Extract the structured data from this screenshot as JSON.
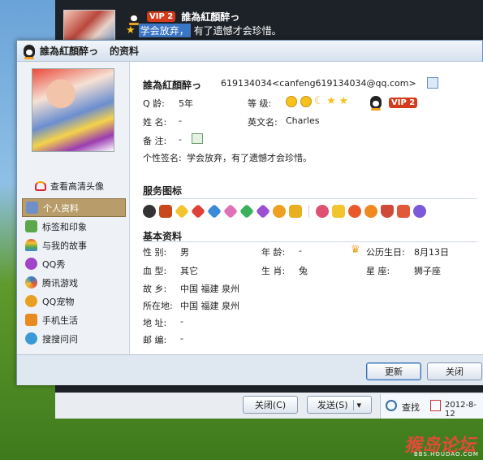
{
  "background_chat": {
    "vip_badge": "VIP 2",
    "nickname": "誰為紅顏醉っ",
    "signature_selected": "学会放弃，",
    "signature_rest": "有了遗憾才会珍惜。",
    "close_button": "关闭(C)",
    "send_button": "发送(S)",
    "find_label": "查找",
    "date_label": "2012-8-12"
  },
  "dialog": {
    "title_name": "誰為紅顏醉っ",
    "title_suffix": "的资料"
  },
  "sidebar": {
    "hd_avatar_link": "查看高清头像",
    "items": [
      {
        "label": "个人资料",
        "icon": "id-card-icon",
        "color": "#6e8fc8"
      },
      {
        "label": "标签和印象",
        "icon": "tag-icon",
        "color": "#5aa84a"
      },
      {
        "label": "与我的故事",
        "icon": "rainbow-icon",
        "color": "#e05a3a"
      },
      {
        "label": "QQ秀",
        "icon": "qqshow-icon",
        "color": "#a044c8"
      },
      {
        "label": "腾讯游戏",
        "icon": "game-icon",
        "color": "#2a7fd0"
      },
      {
        "label": "QQ宠物",
        "icon": "pet-icon",
        "color": "#e8a020"
      },
      {
        "label": "手机生活",
        "icon": "mobile-icon",
        "color": "#e88a20"
      },
      {
        "label": "搜搜问问",
        "icon": "soso-icon",
        "color": "#3a9ad8"
      }
    ]
  },
  "profile": {
    "nickname": "誰為紅顏醉っ",
    "qq_email": "619134034<canfeng619134034@qq.com>",
    "q_age_label": "Q   龄:",
    "q_age": "5年",
    "level_label": "等   级:",
    "vip_badge": "VIP 2",
    "name_label": "姓   名:",
    "name_value": "-",
    "english_name_label": "英文名:",
    "english_name": "Charles",
    "remark_label": "备   注:",
    "remark_value": "-",
    "signature_label": "个性签名:",
    "signature": "学会放弃，有了遗憾才会珍惜。"
  },
  "service_icons": {
    "title": "服务图标"
  },
  "basic_info": {
    "title": "基本资料",
    "gender_label": "性   别:",
    "gender": "男",
    "age_label": "年   龄:",
    "age": "-",
    "birthday_label": "公历生日:",
    "birthday": "8月13日",
    "blood_label": "血   型:",
    "blood": "其它",
    "zodiac_label": "生   肖:",
    "zodiac": "兔",
    "star_label": "星     座:",
    "star": "狮子座",
    "hometown_label": "故   乡:",
    "hometown": "中国 福建 泉州",
    "location_label": "所在地:",
    "location": "中国 福建 泉州",
    "address_label": "地   址:",
    "address": "-",
    "zip_label": "邮   编:",
    "zip": "-"
  },
  "footer": {
    "update_button": "更新",
    "close_button": "关闭"
  },
  "watermark": {
    "text": "猴岛论坛",
    "sub": "BBS.HOUDAO.COM"
  }
}
